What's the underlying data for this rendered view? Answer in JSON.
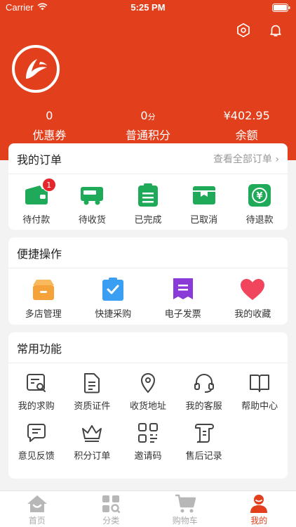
{
  "status_bar": {
    "carrier": "Carrier",
    "time": "5:25 PM"
  },
  "colors": {
    "brand": "#e2401c",
    "green": "#1faa59",
    "orange": "#f6a23a",
    "blue": "#3a9ff2",
    "purple": "#8a3ad6",
    "pink": "#f0455d"
  },
  "stats": [
    {
      "value": "0",
      "unit": "",
      "label": "优惠券"
    },
    {
      "value": "0",
      "unit": "分",
      "label": "普通积分"
    },
    {
      "value": "¥402.95",
      "unit": "",
      "label": "余额"
    }
  ],
  "orders": {
    "title": "我的订单",
    "view_all": "查看全部订单 ›",
    "items": [
      {
        "label": "待付款",
        "icon": "wallet-icon",
        "badge": "1"
      },
      {
        "label": "待收货",
        "icon": "truck-icon"
      },
      {
        "label": "已完成",
        "icon": "clipboard-list-icon"
      },
      {
        "label": "已取消",
        "icon": "box-icon"
      },
      {
        "label": "待退款",
        "icon": "yen-refund-icon"
      }
    ]
  },
  "quick": {
    "title": "便捷操作",
    "items": [
      {
        "label": "多店管理",
        "icon": "store-icon"
      },
      {
        "label": "快捷采购",
        "icon": "clipboard-check-icon"
      },
      {
        "label": "电子发票",
        "icon": "invoice-icon"
      },
      {
        "label": "我的收藏",
        "icon": "heart-icon"
      }
    ]
  },
  "functions": {
    "title": "常用功能",
    "items": [
      {
        "label": "我的求购",
        "icon": "search-doc-icon"
      },
      {
        "label": "资质证件",
        "icon": "document-icon"
      },
      {
        "label": "收货地址",
        "icon": "location-pin-icon"
      },
      {
        "label": "我的客服",
        "icon": "headset-icon"
      },
      {
        "label": "帮助中心",
        "icon": "book-icon"
      },
      {
        "label": "意见反馈",
        "icon": "feedback-icon"
      },
      {
        "label": "积分订单",
        "icon": "crown-icon"
      },
      {
        "label": "邀请码",
        "icon": "qr-code-icon"
      },
      {
        "label": "售后记录",
        "icon": "scroll-icon"
      }
    ]
  },
  "tabs": [
    {
      "label": "首页",
      "icon": "home-icon"
    },
    {
      "label": "分类",
      "icon": "category-icon"
    },
    {
      "label": "购物车",
      "icon": "cart-icon"
    },
    {
      "label": "我的",
      "icon": "user-icon",
      "active": true
    }
  ]
}
